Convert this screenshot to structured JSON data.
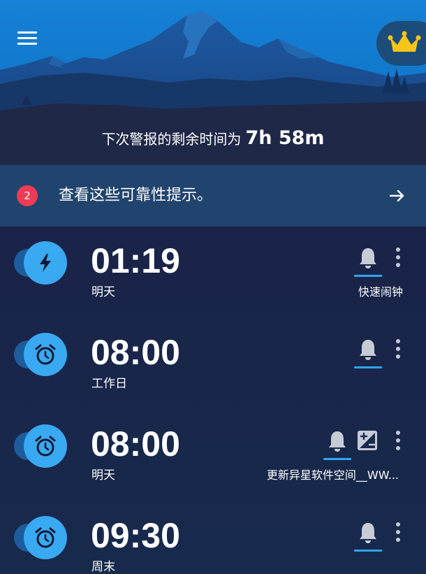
{
  "header": {
    "menu_icon": "hamburger-menu-icon",
    "premium_icon": "crown-icon",
    "next_alarm_prefix": "下次警报的剩余时间为",
    "next_alarm_remaining": "7h 58m"
  },
  "banner": {
    "badge_count": "2",
    "text": "查看这些可靠性提示。",
    "arrow_icon": "arrow-right-icon"
  },
  "alarms": [
    {
      "time": "01:19",
      "subtitle": "明天",
      "enabled": true,
      "type_icon": "lightning-icon",
      "note": "快速闹钟",
      "has_picture_icon": false
    },
    {
      "time": "08:00",
      "subtitle": "工作日",
      "enabled": true,
      "type_icon": "alarm-clock-icon",
      "note": "",
      "has_picture_icon": false
    },
    {
      "time": "08:00",
      "subtitle": "明天",
      "enabled": true,
      "type_icon": "alarm-clock-icon",
      "note": "更新异星软件空间__WW...",
      "has_picture_icon": true
    },
    {
      "time": "09:30",
      "subtitle": "周末",
      "enabled": true,
      "type_icon": "alarm-clock-icon",
      "note": "",
      "has_picture_icon": false
    }
  ],
  "colors": {
    "sky_top": "#1477c9",
    "banner_bg": "#20446d",
    "list_bg": "#1a2347",
    "accent_blue": "#39a9f2",
    "badge_red": "#ef3b55",
    "crown_yellow": "#f5c518"
  }
}
